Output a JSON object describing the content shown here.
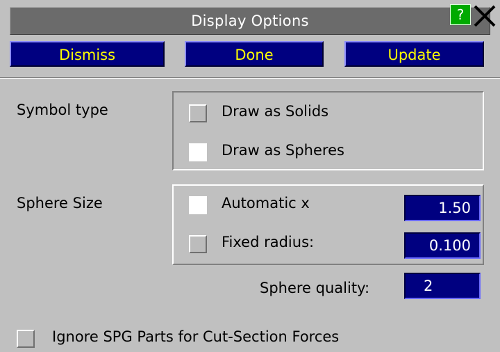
{
  "window": {
    "title": "Display Options"
  },
  "titlebar": {
    "help_label": "?"
  },
  "buttons": {
    "dismiss": "Dismiss",
    "done": "Done",
    "update": "Update"
  },
  "symbol_type": {
    "label": "Symbol type",
    "options": [
      {
        "label": "Draw as Solids",
        "checked": false
      },
      {
        "label": "Draw as Spheres",
        "checked": true
      }
    ]
  },
  "sphere_size": {
    "label": "Sphere Size",
    "automatic": {
      "label": "Automatic x",
      "value": "1.50",
      "checked": true
    },
    "fixed": {
      "label": "Fixed radius:",
      "value": "0.100",
      "checked": false
    }
  },
  "sphere_quality": {
    "label": "Sphere quality:",
    "value": "2"
  },
  "ignore_spg": {
    "label": "Ignore SPG Parts for Cut-Section Forces",
    "checked": false
  },
  "colors": {
    "button_bg": "#000080",
    "button_text": "#ffff00",
    "panel_bg": "#c0c0c0",
    "help_bg": "#00aa00"
  }
}
